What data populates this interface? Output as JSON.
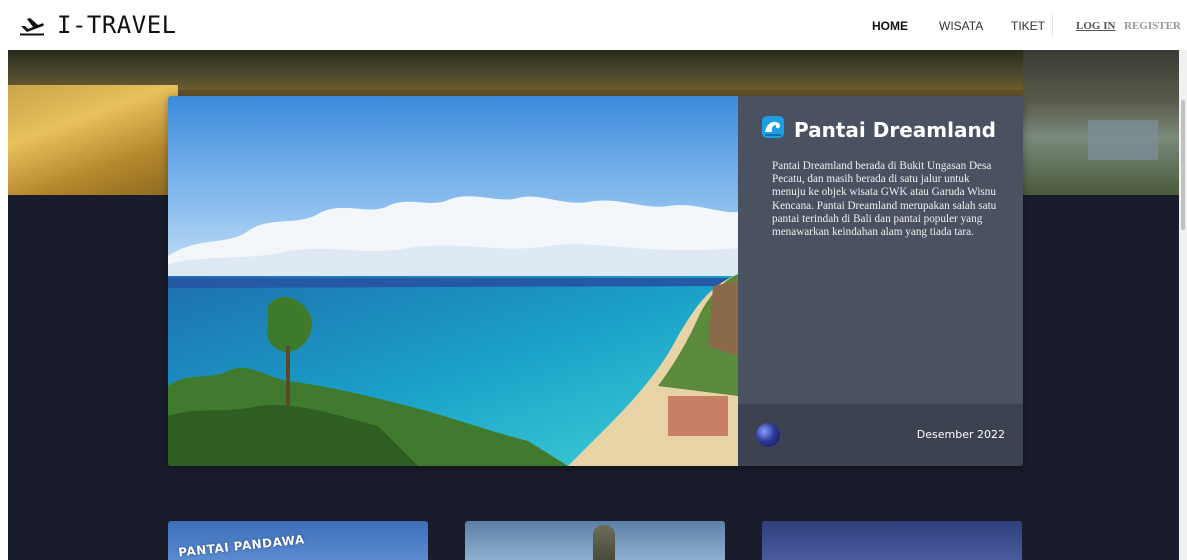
{
  "header": {
    "brand": "I-TRAVEL",
    "logo_icon": "plane-departure-icon",
    "nav": {
      "home": "HOME",
      "wisata": "WISATA",
      "tiket": "TIKET",
      "login": "LOG IN",
      "register": "REGISTER"
    }
  },
  "featured": {
    "icon": "wave-icon",
    "title": "Pantai Dreamland",
    "description": "Pantai Dreamland berada di Bukit Ungasan Desa Pecatu, dan masih berada di satu jalur untuk menuju ke objek wisata GWK atau Garuda Wisnu Kencana. Pantai Dreamland merupakan salah satu pantai terindah di Bali dan pantai populer yang menawarkan keindahan alam yang tiada tara.",
    "date": "Desember 2022"
  },
  "thumbnails": [
    {
      "label": "PANTAI PANDAWA"
    },
    {
      "label": ""
    },
    {
      "label": ""
    }
  ],
  "colors": {
    "dark_background": "#191c2b",
    "panel": "#4a5160",
    "panel_footer": "#3c424f"
  }
}
